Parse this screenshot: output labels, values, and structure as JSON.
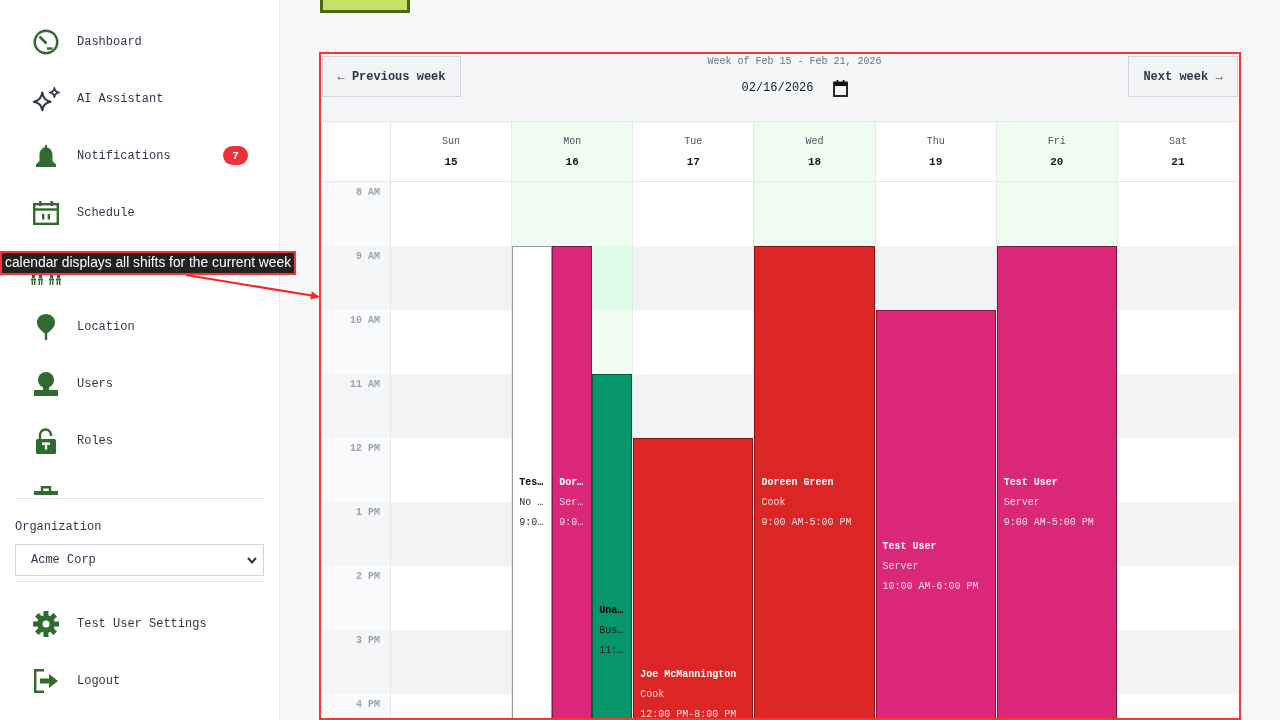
{
  "sidebar": {
    "nav_items": [
      {
        "label": "Dashboard"
      },
      {
        "label": "AI Assistant"
      },
      {
        "label": "Notifications",
        "badge": "7"
      },
      {
        "label": "Schedule"
      },
      {
        "label": "Location"
      },
      {
        "label": "Users"
      },
      {
        "label": "Roles"
      }
    ],
    "organization": {
      "label": "Organization",
      "value": "Acme Corp"
    },
    "footer_items": [
      {
        "label": "Test User Settings"
      },
      {
        "label": "Logout"
      }
    ]
  },
  "calendar": {
    "previous_button": "← Previous week",
    "week_range": "Week of Feb 15 - Feb 21, 2026",
    "date_input": {
      "value": "02/16/2026"
    },
    "next_button": "Next week →",
    "days": [
      {
        "name": "Sun",
        "date": "15",
        "highlighted": false
      },
      {
        "name": "Mon",
        "date": "16",
        "highlighted": true,
        "shifts": [
          {
            "name": "Tes…",
            "role": "No …",
            "time": "9:0…",
            "color": "#ffffff"
          },
          {
            "name": "Dor…",
            "role": "Ser…",
            "time": "9:0…",
            "color": "#db2777"
          },
          {
            "name": "Una…",
            "role": "Bus…",
            "time": "11:…",
            "color": "#059669"
          }
        ]
      },
      {
        "name": "Tue",
        "date": "17",
        "highlighted": false,
        "shifts": [
          {
            "name": "Joe McMannington",
            "role": "Cook",
            "time": "12:00 PM-8:00 PM",
            "color": "#dc2626"
          }
        ]
      },
      {
        "name": "Wed",
        "date": "18",
        "highlighted": true,
        "shifts": [
          {
            "name": "Doreen Green",
            "role": "Cook",
            "time": "9:00 AM-5:00 PM",
            "color": "#dc2626"
          }
        ]
      },
      {
        "name": "Thu",
        "date": "19",
        "highlighted": false,
        "shifts": [
          {
            "name": "Test User",
            "role": "Server",
            "time": "10:00 AM-6:00 PM",
            "color": "#db2777"
          }
        ]
      },
      {
        "name": "Fri",
        "date": "20",
        "highlighted": true,
        "shifts": [
          {
            "name": "Test User",
            "role": "Server",
            "time": "9:00 AM-5:00 PM",
            "color": "#db2777"
          }
        ]
      },
      {
        "name": "Sat",
        "date": "21",
        "highlighted": false
      }
    ],
    "time_rows": [
      {
        "label": "8 AM"
      },
      {
        "label": "9 AM"
      },
      {
        "label": "10 AM"
      },
      {
        "label": "11 AM"
      },
      {
        "label": "12 PM"
      },
      {
        "label": "1 PM"
      },
      {
        "label": "2 PM"
      },
      {
        "label": "3 PM"
      },
      {
        "label": "4 PM"
      }
    ]
  },
  "annotation": {
    "text": "calendar displays all shifts for the current week"
  }
}
